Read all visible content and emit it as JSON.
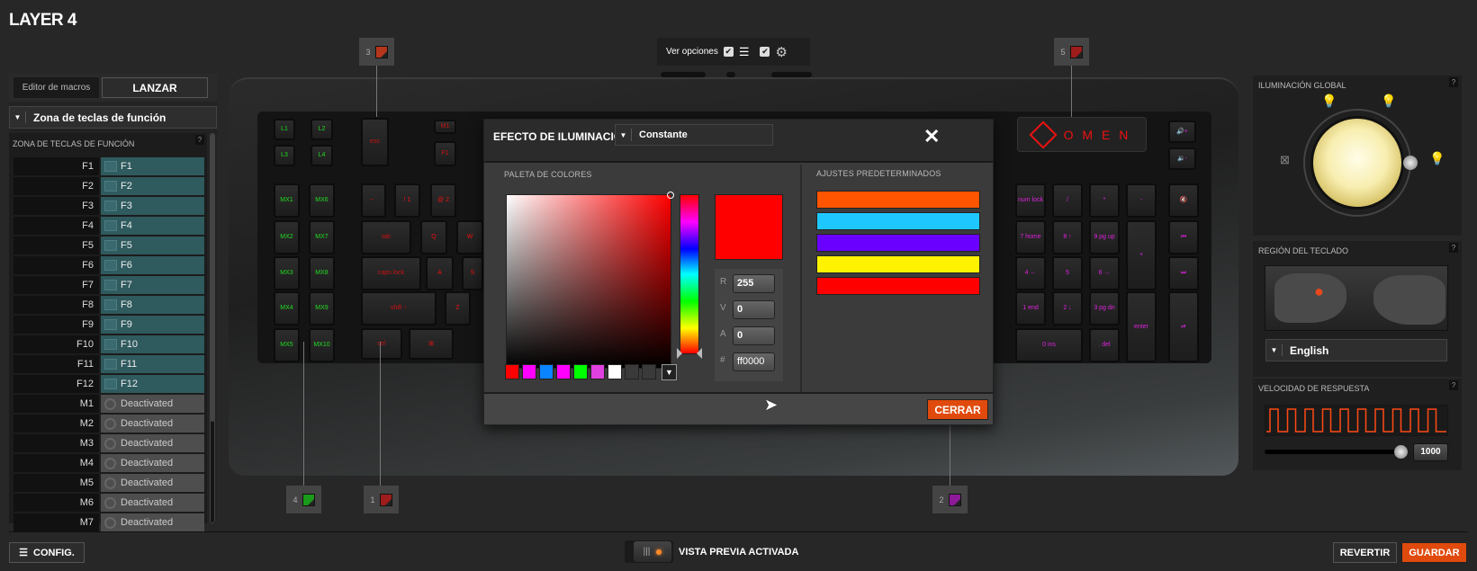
{
  "title": "LAYER 4",
  "left": {
    "editor_label": "Editor de macros",
    "launch_label": "LANZAR",
    "zone_dropdown": "Zona de teclas de función",
    "list_header": "ZONA DE TECLAS DE FUNCIÓN",
    "help": "?",
    "rows": [
      {
        "key": "F1",
        "value": "F1",
        "type": "key"
      },
      {
        "key": "F2",
        "value": "F2",
        "type": "key"
      },
      {
        "key": "F3",
        "value": "F3",
        "type": "key"
      },
      {
        "key": "F4",
        "value": "F4",
        "type": "key"
      },
      {
        "key": "F5",
        "value": "F5",
        "type": "key"
      },
      {
        "key": "F6",
        "value": "F6",
        "type": "key"
      },
      {
        "key": "F7",
        "value": "F7",
        "type": "key"
      },
      {
        "key": "F8",
        "value": "F8",
        "type": "key"
      },
      {
        "key": "F9",
        "value": "F9",
        "type": "key"
      },
      {
        "key": "F10",
        "value": "F10",
        "type": "key"
      },
      {
        "key": "F11",
        "value": "F11",
        "type": "key"
      },
      {
        "key": "F12",
        "value": "F12",
        "type": "key"
      },
      {
        "key": "M1",
        "value": "Deactivated",
        "type": "off"
      },
      {
        "key": "M2",
        "value": "Deactivated",
        "type": "off"
      },
      {
        "key": "M3",
        "value": "Deactivated",
        "type": "off"
      },
      {
        "key": "M4",
        "value": "Deactivated",
        "type": "off"
      },
      {
        "key": "M5",
        "value": "Deactivated",
        "type": "off"
      },
      {
        "key": "M6",
        "value": "Deactivated",
        "type": "off"
      },
      {
        "key": "M7",
        "value": "Deactivated",
        "type": "off"
      }
    ]
  },
  "view_options": {
    "label": "Ver opciones",
    "list_checked": true,
    "settings_checked": true
  },
  "callouts": [
    {
      "num": "3",
      "color": "#b5361c"
    },
    {
      "num": "5",
      "color": "#9e1c1c"
    },
    {
      "num": "4",
      "color": "#1a9a1a"
    },
    {
      "num": "1",
      "color": "#9e1c1c"
    },
    {
      "num": "2",
      "color": "#8e1a9a"
    }
  ],
  "keyboard": {
    "brand": "O M E N",
    "keys": [
      {
        "t": "L1",
        "c": "#22dd22"
      },
      {
        "t": "L2",
        "c": "#22dd22"
      },
      {
        "t": "L3",
        "c": "#22dd22"
      },
      {
        "t": "L4",
        "c": "#22dd22"
      },
      {
        "t": "esc",
        "c": "#cc1111"
      },
      {
        "t": "M1",
        "c": "#cc1111"
      },
      {
        "t": "F1",
        "c": "#cc1111"
      },
      {
        "t": "MX1",
        "c": "#22dd22"
      },
      {
        "t": "MX6",
        "c": "#22dd22"
      },
      {
        "t": "MX2",
        "c": "#22dd22"
      },
      {
        "t": "MX7",
        "c": "#22dd22"
      },
      {
        "t": "MX3",
        "c": "#22dd22"
      },
      {
        "t": "MX8",
        "c": "#22dd22"
      },
      {
        "t": "MX4",
        "c": "#22dd22"
      },
      {
        "t": "MX9",
        "c": "#22dd22"
      },
      {
        "t": "MX5",
        "c": "#22dd22"
      },
      {
        "t": "MX10",
        "c": "#22dd22"
      },
      {
        "t": "~ `",
        "c": "#cc1111"
      },
      {
        "t": "! 1",
        "c": "#ee1111"
      },
      {
        "t": "@ 2",
        "c": "#ee1111"
      },
      {
        "t": "tab",
        "c": "#cc1111"
      },
      {
        "t": "Q",
        "c": "#ee1111"
      },
      {
        "t": "W",
        "c": "#ee1111"
      },
      {
        "t": "caps lock",
        "c": "#cc1111"
      },
      {
        "t": "A",
        "c": "#ee1111"
      },
      {
        "t": "S",
        "c": "#ee1111"
      },
      {
        "t": "shift ↑",
        "c": "#cc1111"
      },
      {
        "t": "Z",
        "c": "#ee1111"
      },
      {
        "t": "ctrl",
        "c": "#cc1111"
      },
      {
        "t": "⊞",
        "c": "#ee1111"
      },
      {
        "t": "num lock",
        "c": "#dd22dd"
      },
      {
        "t": "/",
        "c": "#dd22dd"
      },
      {
        "t": "*",
        "c": "#dd22dd"
      },
      {
        "t": "-",
        "c": "#dd22dd"
      },
      {
        "t": "7 home",
        "c": "#dd22dd"
      },
      {
        "t": "8 ↑",
        "c": "#dd22dd"
      },
      {
        "t": "9 pg up",
        "c": "#dd22dd"
      },
      {
        "t": "+",
        "c": "#dd22dd"
      },
      {
        "t": "4 ←",
        "c": "#dd22dd"
      },
      {
        "t": "5",
        "c": "#dd22dd"
      },
      {
        "t": "6 →",
        "c": "#dd22dd"
      },
      {
        "t": "1 end",
        "c": "#dd22dd"
      },
      {
        "t": "2 ↓",
        "c": "#dd22dd"
      },
      {
        "t": "3 pg dn",
        "c": "#dd22dd"
      },
      {
        "t": "enter",
        "c": "#dd22dd"
      },
      {
        "t": "0 ins",
        "c": "#dd22dd"
      },
      {
        "t": ". del",
        "c": "#dd22dd"
      },
      {
        "t": "🔊+",
        "c": "#dd22dd"
      },
      {
        "t": "🔉-",
        "c": "#dd22dd"
      },
      {
        "t": "🔇",
        "c": "#dd22dd"
      },
      {
        "t": "⏮",
        "c": "#dd22dd"
      },
      {
        "t": "⏭",
        "c": "#dd22dd"
      },
      {
        "t": "⏯",
        "c": "#dd22dd"
      }
    ]
  },
  "dialog": {
    "title": "EFECTO DE ILUMINACIÓN",
    "effect": "Constante",
    "palette_label": "PALETA DE COLORES",
    "presets_label": "AJUSTES PREDETERMINADOS",
    "selected_color": "#ff0000",
    "r_label": "R",
    "r": "255",
    "v_label": "V",
    "v": "0",
    "a_label": "A",
    "a": "0",
    "hex_label": "#",
    "hex": "ff0000",
    "swatches": [
      "#ff0000",
      "#ff00ff",
      "#0a84ff",
      "#ff00ff",
      "#00ff00",
      "#e040e0",
      "#ffffff",
      "#3a3a3a",
      "#3a3a3a"
    ],
    "presets": [
      "#ff5500",
      "#1ec8ff",
      "#6a00ff",
      "#fff200",
      "#ff0000"
    ],
    "close_label": "CERRAR"
  },
  "right": {
    "global_title": "ILUMINACIÓN GLOBAL",
    "region_title": "REGIÓN DEL TECLADO",
    "region_value": "English",
    "speed_title": "VELOCIDAD DE RESPUESTA",
    "speed_value": "1000",
    "help": "?",
    "brightness_level": "max"
  },
  "bottom": {
    "config_label": "CONFIG.",
    "preview_label": "VISTA PREVIA ACTIVADA",
    "revert_label": "REVERTIR",
    "save_label": "GUARDAR"
  }
}
